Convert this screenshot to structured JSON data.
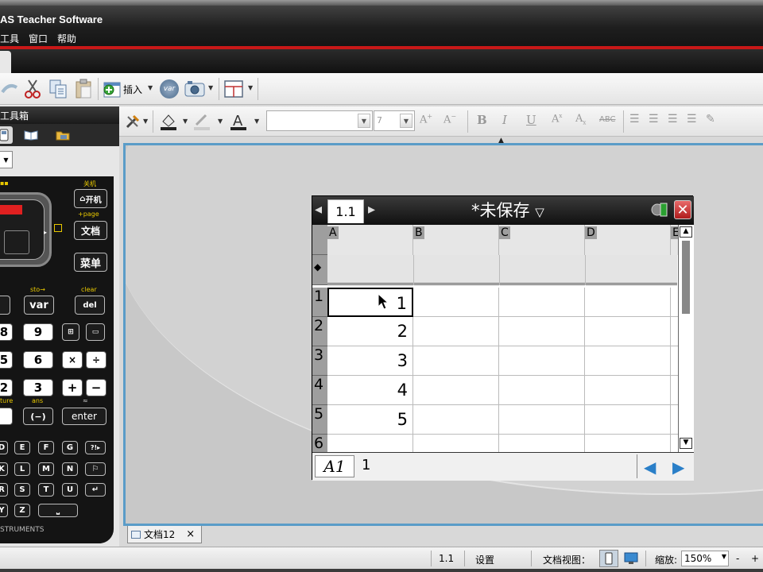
{
  "window": {
    "title": "AS Teacher Software"
  },
  "menu": [
    "工具",
    "窗口",
    "帮助"
  ],
  "toolbar": {
    "insert_label": "插入",
    "var_label": "var"
  },
  "toolbox": {
    "title": "工具箱"
  },
  "calculator": {
    "labels": {
      "off": "关机",
      "page": "+page",
      "sto": "sto→",
      "clear": "clear",
      "ans": "ans",
      "approx": "≈",
      "ture": "ture",
      "brand": "STRUMENTS"
    },
    "keys": {
      "home": "开机",
      "doc": "文档",
      "menu": "菜单",
      "var": "var",
      "del": "del",
      "nine": "9",
      "eight": "8",
      "six": "6",
      "five": "5",
      "three": "3",
      "two": "2",
      "times": "×",
      "divide": "÷",
      "plus": "+",
      "minus": "−",
      "neg": "(−)",
      "enter": "enter"
    },
    "letters": [
      [
        "D",
        "E",
        "F",
        "G",
        "?!▸"
      ],
      [
        "K",
        "L",
        "M",
        "N",
        "⚐"
      ],
      [
        "R",
        "S",
        "T",
        "U",
        "↵"
      ],
      [
        "Y",
        "Z",
        "⎵"
      ]
    ]
  },
  "format_toolbar": {
    "font_size": "7"
  },
  "handheld": {
    "tab_label": "1.1",
    "title": "*未保存",
    "columns": [
      "A",
      "B",
      "C",
      "D",
      "E"
    ],
    "formula_row_marker": "◆",
    "row_numbers": [
      "1",
      "2",
      "3",
      "4",
      "5",
      "6"
    ],
    "column_a_values": [
      "1",
      "2",
      "3",
      "4",
      "5"
    ],
    "entry": {
      "cell_ref": "A1",
      "value": "1"
    }
  },
  "document_tab": {
    "label": "文档12",
    "close": "×"
  },
  "status_bar": {
    "page": "1.1",
    "settings": "设置",
    "doc_view": "文档视图：",
    "zoom_label": "缩放:",
    "zoom_value": "150%",
    "zoom_minus": "-",
    "zoom_plus": "+"
  },
  "colors": {
    "accent_red": "#c81818",
    "workspace_border": "#5a9cc8",
    "close_red": "#c83232",
    "nav_blue": "#2a7fc8"
  }
}
